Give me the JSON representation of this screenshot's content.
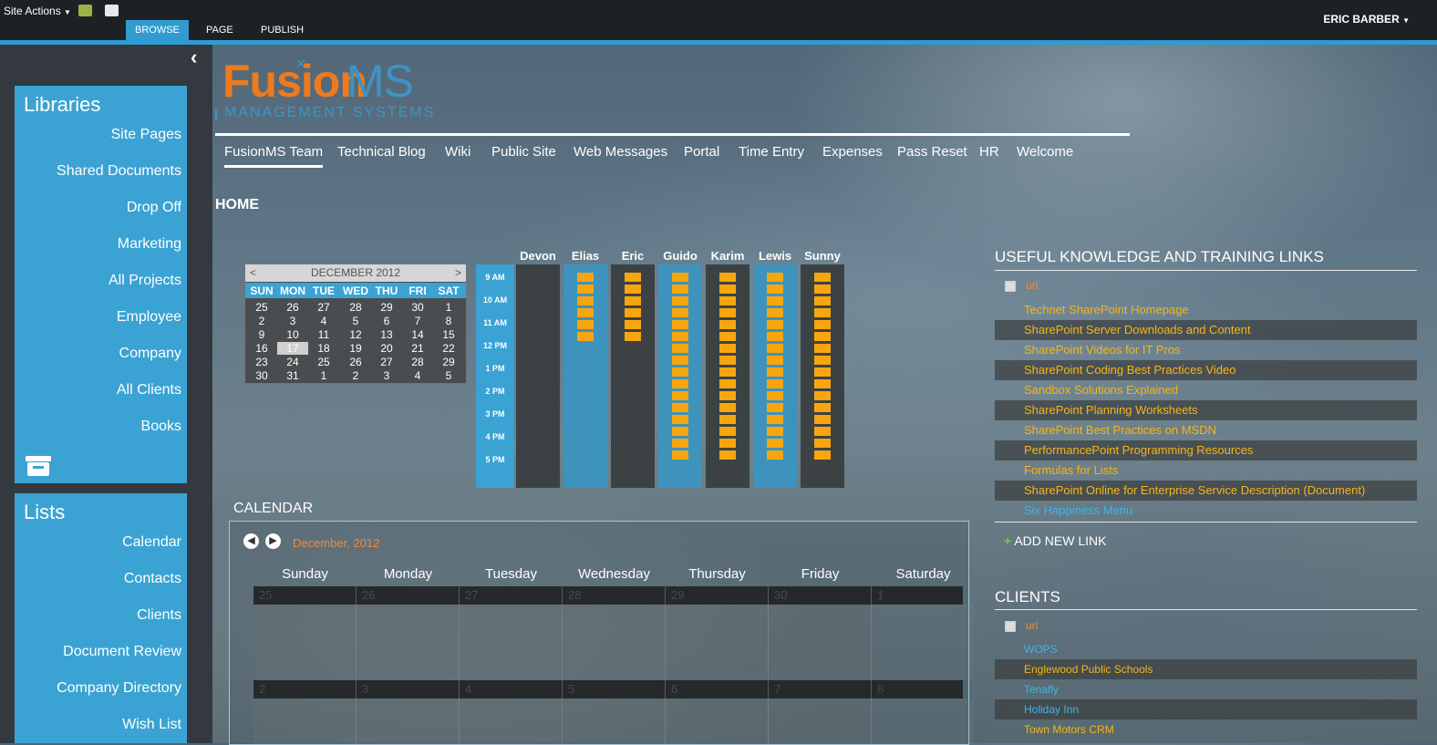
{
  "ribbon": {
    "site_actions": "Site Actions",
    "tabs": [
      "BROWSE",
      "PAGE",
      "PUBLISH"
    ],
    "user": "ERIC BARBER"
  },
  "libraries": {
    "title": "Libraries",
    "items": [
      "Site Pages",
      "Shared Documents",
      "Drop Off",
      "Marketing",
      "All Projects",
      "Employee",
      "Company",
      "All Clients",
      "Books"
    ]
  },
  "lists": {
    "title": "Lists",
    "items": [
      "Calendar",
      "Contacts",
      "Clients",
      "Document Review",
      "Company Directory",
      "Wish List"
    ]
  },
  "logo": {
    "word1": "Fusion",
    "word2": "MS",
    "tagline": "MANAGEMENT SYSTEMS"
  },
  "topnav": [
    "FusionMS Team",
    "Technical Blog",
    "Wiki",
    "Public Site",
    "Web Messages",
    "Portal",
    "Time Entry",
    "Expenses",
    "Pass Reset",
    "HR",
    "Welcome"
  ],
  "page_heading": "HOME",
  "mini_calendar": {
    "prev": "<",
    "next": ">",
    "month": "DECEMBER 2012",
    "days": [
      "SUN",
      "MON",
      "TUE",
      "WED",
      "THU",
      "FRI",
      "SAT"
    ],
    "weeks": [
      [
        "25",
        "26",
        "27",
        "28",
        "29",
        "30",
        "1"
      ],
      [
        "2",
        "3",
        "4",
        "5",
        "6",
        "7",
        "8"
      ],
      [
        "9",
        "10",
        "11",
        "12",
        "13",
        "14",
        "15"
      ],
      [
        "16",
        "17",
        "18",
        "19",
        "20",
        "21",
        "22"
      ],
      [
        "23",
        "24",
        "25",
        "26",
        "27",
        "28",
        "29"
      ],
      [
        "30",
        "31",
        "1",
        "2",
        "3",
        "4",
        "5"
      ]
    ],
    "today": "17"
  },
  "schedule": {
    "times": [
      "9 AM",
      "10 AM",
      "11 AM",
      "12 PM",
      "1 PM",
      "2 PM",
      "3 PM",
      "4 PM",
      "5 PM"
    ],
    "people": [
      {
        "name": "Devon",
        "booked_slots": 0
      },
      {
        "name": "Elias",
        "booked_slots": 6
      },
      {
        "name": "Eric",
        "booked_slots": 6
      },
      {
        "name": "Guido",
        "booked_slots": 16
      },
      {
        "name": "Karim",
        "booked_slots": 16
      },
      {
        "name": "Lewis",
        "booked_slots": 16
      },
      {
        "name": "Sunny",
        "booked_slots": 16
      }
    ]
  },
  "calendar": {
    "title": "CALENDAR",
    "month_label": "December, 2012",
    "weekdays": [
      "Sunday",
      "Monday",
      "Tuesday",
      "Wednesday",
      "Thursday",
      "Friday",
      "Saturday"
    ],
    "week1": [
      "25",
      "26",
      "27",
      "28",
      "29",
      "30",
      "1"
    ],
    "week2": [
      "2",
      "3",
      "4",
      "5",
      "6",
      "7",
      "8"
    ]
  },
  "useful_links": {
    "title": "USEFUL KNOWLEDGE AND TRAINING LINKS",
    "header": "url",
    "items": [
      "Technet SharePoint Homepage",
      "SharePoint Server Downloads and Content",
      "SharePoint Videos for IT Pros",
      "SharePoint Coding Best Practices Video",
      "Sandbox Solutions Explained",
      "SharePoint Planning Worksheets",
      "SharePoint Best Practices on MSDN",
      "PerformancePoint Programming Resources",
      "Formulas for Lists",
      "SharePoint Online for Enterprise Service Description (Document)",
      "Six Happiness Menu"
    ],
    "add": "ADD NEW LINK"
  },
  "clients": {
    "title": "CLIENTS",
    "header": "url",
    "items": [
      "WOPS",
      "Englewood Public Schools",
      "Tenafly",
      "Holiday Inn",
      "Town Motors CRM"
    ]
  },
  "colors": {
    "accent": "#3aa3d3",
    "orange": "#ee7a1e",
    "slot": "#f7a60f",
    "link_orange": "#f7b514",
    "link_blue": "#3fb4ec"
  }
}
